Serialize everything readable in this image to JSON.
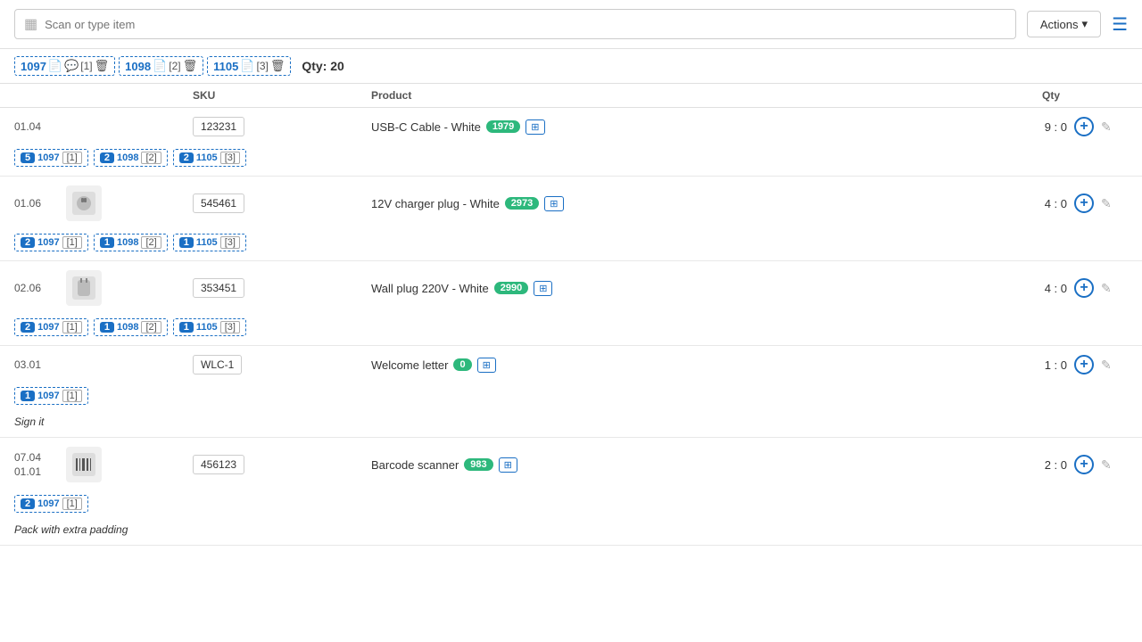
{
  "topbar": {
    "scan_placeholder": "Scan or type item",
    "actions_label": "Actions",
    "actions_arrow": "▾"
  },
  "order_tabs": [
    {
      "id": "1097",
      "icon": "📄",
      "badge": "",
      "count": "[1]",
      "has_chat": true,
      "chat_count": "[1]"
    },
    {
      "id": "1098",
      "icon": "📄",
      "badge": "",
      "count": "[2]"
    },
    {
      "id": "1105",
      "icon": "📄",
      "badge": "",
      "count": "[3]"
    }
  ],
  "qty_total_label": "Qty:",
  "qty_total_value": "20",
  "table_headers": {
    "sku": "SKU",
    "product": "Product",
    "qty": "Qty"
  },
  "products": [
    {
      "location": "01.04",
      "has_image": false,
      "sku": "123231",
      "name": "USB-C Cable - White",
      "badge": "1979",
      "qty": "9 : 0",
      "tags": [
        {
          "num": "5",
          "id": "1097",
          "count": "[1]"
        },
        {
          "num": "2",
          "id": "1098",
          "count": "[2]"
        },
        {
          "num": "2",
          "id": "1105",
          "count": "[3]"
        }
      ],
      "note": ""
    },
    {
      "location": "01.06",
      "has_image": true,
      "image_alt": "12V charger plug",
      "sku": "545461",
      "name": "12V charger plug - White",
      "badge": "2973",
      "qty": "4 : 0",
      "tags": [
        {
          "num": "2",
          "id": "1097",
          "count": "[1]"
        },
        {
          "num": "1",
          "id": "1098",
          "count": "[2]"
        },
        {
          "num": "1",
          "id": "1105",
          "count": "[3]"
        }
      ],
      "note": ""
    },
    {
      "location": "02.06",
      "has_image": true,
      "image_alt": "Wall plug",
      "sku": "353451",
      "name": "Wall plug 220V - White",
      "badge": "2990",
      "qty": "4 : 0",
      "tags": [
        {
          "num": "2",
          "id": "1097",
          "count": "[1]"
        },
        {
          "num": "1",
          "id": "1098",
          "count": "[2]"
        },
        {
          "num": "1",
          "id": "1105",
          "count": "[3]"
        }
      ],
      "note": ""
    },
    {
      "location": "03.01",
      "has_image": false,
      "sku": "WLC-1",
      "name": "Welcome letter",
      "badge": "0",
      "badge_color": "green",
      "qty": "1 : 0",
      "tags": [
        {
          "num": "1",
          "id": "1097",
          "count": "[1]"
        }
      ],
      "note": "Sign it"
    },
    {
      "location_multi": [
        "07.04",
        "01.01"
      ],
      "has_image": true,
      "image_alt": "Barcode scanner",
      "sku": "456123",
      "name": "Barcode scanner",
      "badge": "983",
      "qty": "2 : 0",
      "tags": [
        {
          "num": "2",
          "id": "1097",
          "count": "[1]"
        }
      ],
      "note": "Pack with extra padding"
    }
  ]
}
